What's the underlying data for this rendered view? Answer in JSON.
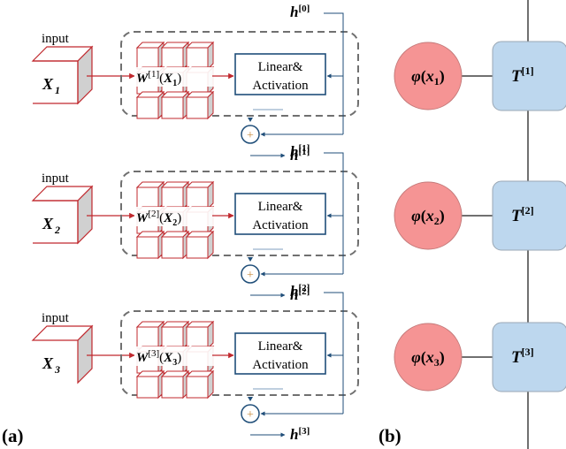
{
  "panel_a": {
    "label": "(a)",
    "blocks": [
      {
        "input_label": "input",
        "input_var": "X",
        "input_sub": "1",
        "weight_var": "W",
        "weight_sup": "[1]",
        "weight_arg_var": "X",
        "weight_arg_sub": "1",
        "linear_line1": "Linear&",
        "linear_line2": "Activation",
        "h_in_var": "h",
        "h_in_sup": "[0]",
        "h_out_var": "h",
        "h_out_sup": "[1]",
        "input_shape": "cube"
      },
      {
        "input_label": "input",
        "input_var": "X",
        "input_sub": "2",
        "weight_var": "W",
        "weight_sup": "[2]",
        "weight_arg_var": "X",
        "weight_arg_sub": "2",
        "linear_line1": "Linear&",
        "linear_line2": "Activation",
        "h_in_var": "h",
        "h_in_sup": "[1]",
        "h_out_var": "h",
        "h_out_sup": "[2]",
        "input_shape": "cube"
      },
      {
        "input_label": "input",
        "input_var": "X",
        "input_sub": "3",
        "weight_var": "W",
        "weight_sup": "[3]",
        "weight_arg_var": "X",
        "weight_arg_sub": "3",
        "linear_line1": "Linear&",
        "linear_line2": "Activation",
        "h_in_var": "h",
        "h_in_sup": "[2]",
        "h_out_var": "h",
        "h_out_sup": "[3]",
        "input_shape": "slice"
      }
    ],
    "plus_symbol": "+"
  },
  "panel_b": {
    "label": "(b)",
    "nodes": [
      {
        "phi": "φ",
        "arg_var": "x",
        "arg_sub": "1",
        "core_var": "T",
        "core_sup": "[1]"
      },
      {
        "phi": "φ",
        "arg_var": "x",
        "arg_sub": "2",
        "core_var": "T",
        "core_sup": "[2]"
      },
      {
        "phi": "φ",
        "arg_var": "x",
        "arg_sub": "3",
        "core_var": "T",
        "core_sup": "[3]"
      }
    ]
  },
  "colors": {
    "red": "#c0282d",
    "blue": "#1f4e79",
    "dash_gray": "#707070",
    "phi_fill": "#f59494",
    "core_fill": "#bdd7ee",
    "core_stroke": "#9aa7b4",
    "gray_side": "#d0d0d0"
  }
}
